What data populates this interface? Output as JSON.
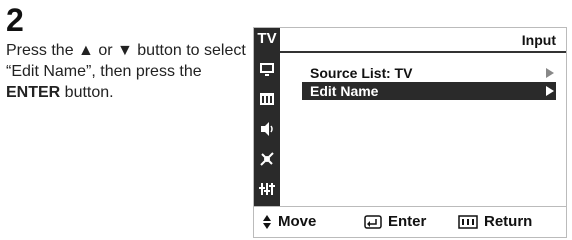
{
  "step": {
    "number": "2",
    "instruction_prefix": "Press the ▲ or ▼ button to select “Edit Name”, then press the ",
    "instruction_bold": "ENTER",
    "instruction_suffix": " button."
  },
  "menu": {
    "sidebar_top": "TV",
    "title": "Input",
    "rows": [
      {
        "label": "Source List",
        "value": ": TV"
      },
      {
        "label": "Edit Name",
        "value": ""
      }
    ],
    "footer": {
      "move": "Move",
      "enter": "Enter",
      "return": "Return"
    }
  },
  "icons": {
    "sidebar": [
      "picture-icon",
      "sound-icon",
      "channel-icon",
      "speaker-icon",
      "antenna-icon",
      "setup-icon"
    ]
  }
}
